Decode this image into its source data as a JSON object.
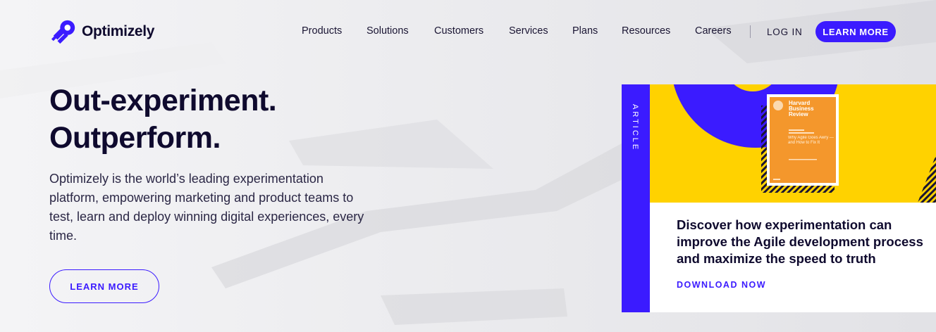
{
  "brand": {
    "name": "Optimizely",
    "accent": "#3b1bff",
    "yellow": "#ffd200",
    "ink": "#0f0a2e"
  },
  "nav": {
    "items": [
      "Products",
      "Solutions",
      "Customers",
      "Services",
      "Plans",
      "Resources",
      "Careers"
    ],
    "login": "LOG IN",
    "cta": "LEARN MORE"
  },
  "hero": {
    "title_line1": "Out-experiment.",
    "title_line2": "Outperform.",
    "description": "Optimizely is the world’s leading experimentation platform, empowering marketing and product teams to test, learn and deploy winning digital experiences, every time.",
    "button": "LEARN MORE"
  },
  "card": {
    "tag": "ARTICLE",
    "book": {
      "brand_line1": "Harvard",
      "brand_line2": "Business",
      "brand_line3": "Review",
      "subtitle": "Why Agile Goes Awry — and How to Fix It"
    },
    "title": "Discover how experimentation can improve the Agile development process and maximize the speed to truth",
    "link": "DOWNLOAD NOW"
  }
}
